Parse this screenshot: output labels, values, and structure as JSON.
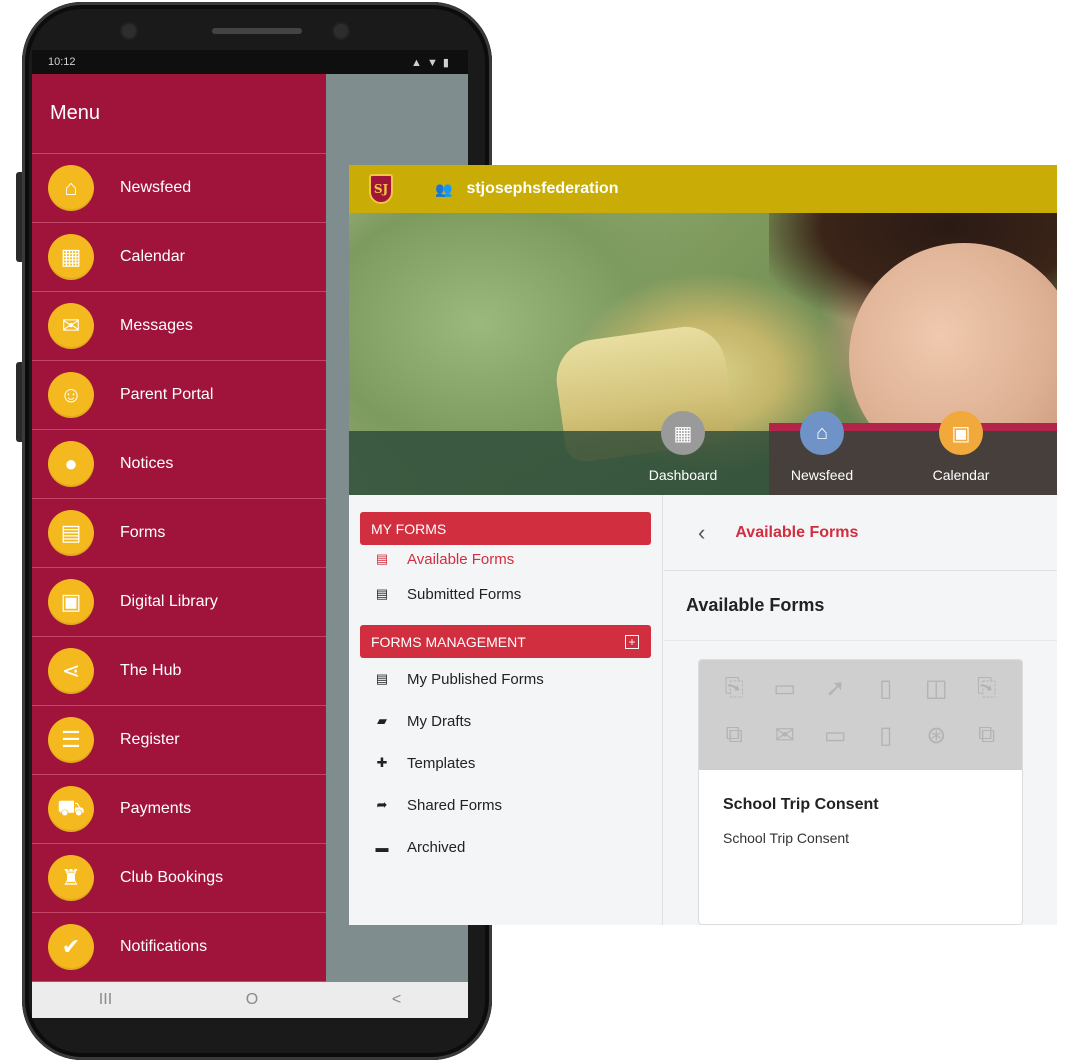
{
  "phone": {
    "status_time": "10:12",
    "status_right": "▲ ▼ ▮",
    "menu_title": "Menu",
    "menu_items": [
      {
        "label": "Newsfeed",
        "icon": "home-icon"
      },
      {
        "label": "Calendar",
        "icon": "calendar-icon"
      },
      {
        "label": "Messages",
        "icon": "envelope-icon"
      },
      {
        "label": "Parent Portal",
        "icon": "people-icon"
      },
      {
        "label": "Notices",
        "icon": "pin-icon"
      },
      {
        "label": "Forms",
        "icon": "forms-icon"
      },
      {
        "label": "Digital Library",
        "icon": "library-icon"
      },
      {
        "label": "The Hub",
        "icon": "share-icon"
      },
      {
        "label": "Register",
        "icon": "list-icon"
      },
      {
        "label": "Payments",
        "icon": "cart-icon"
      },
      {
        "label": "Club Bookings",
        "icon": "shirt-icon"
      },
      {
        "label": "Notifications",
        "icon": "bell-calendar-icon"
      }
    ],
    "nav": {
      "recent": "III",
      "home": "O",
      "back": "<"
    }
  },
  "web": {
    "site_name": "stjosephsfederation",
    "crest_text": "SJ",
    "quick_links": [
      {
        "label": "Dashboard",
        "icon": "dashboard-icon",
        "color": "#9a9a9a"
      },
      {
        "label": "Newsfeed",
        "icon": "home-icon",
        "color": "#6f93c6"
      },
      {
        "label": "Calendar",
        "icon": "calendar-icon",
        "color": "#f2a93b"
      }
    ],
    "sidebar": {
      "my_forms_header": "MY FORMS",
      "my_forms": [
        {
          "label": "Available Forms",
          "icon": "clipboard-icon",
          "active": true
        },
        {
          "label": "Submitted Forms",
          "icon": "clipboard-icon",
          "active": false
        }
      ],
      "management_header": "FORMS MANAGEMENT",
      "management": [
        {
          "label": "My Published Forms",
          "icon": "clipboard-icon"
        },
        {
          "label": "My Drafts",
          "icon": "folder-open-icon"
        },
        {
          "label": "Templates",
          "icon": "puzzle-icon"
        },
        {
          "label": "Shared Forms",
          "icon": "share-arrow-icon"
        },
        {
          "label": "Archived",
          "icon": "archive-icon"
        }
      ]
    },
    "breadcrumb": "Available Forms",
    "main_title": "Available Forms",
    "card": {
      "title": "School Trip Consent",
      "subtitle": "School Trip Consent"
    },
    "colors": {
      "accent": "#d12e3f",
      "topbar": "#c9ad06",
      "drawer": "#a0143b",
      "menu_icon": "#f4b91f"
    }
  }
}
